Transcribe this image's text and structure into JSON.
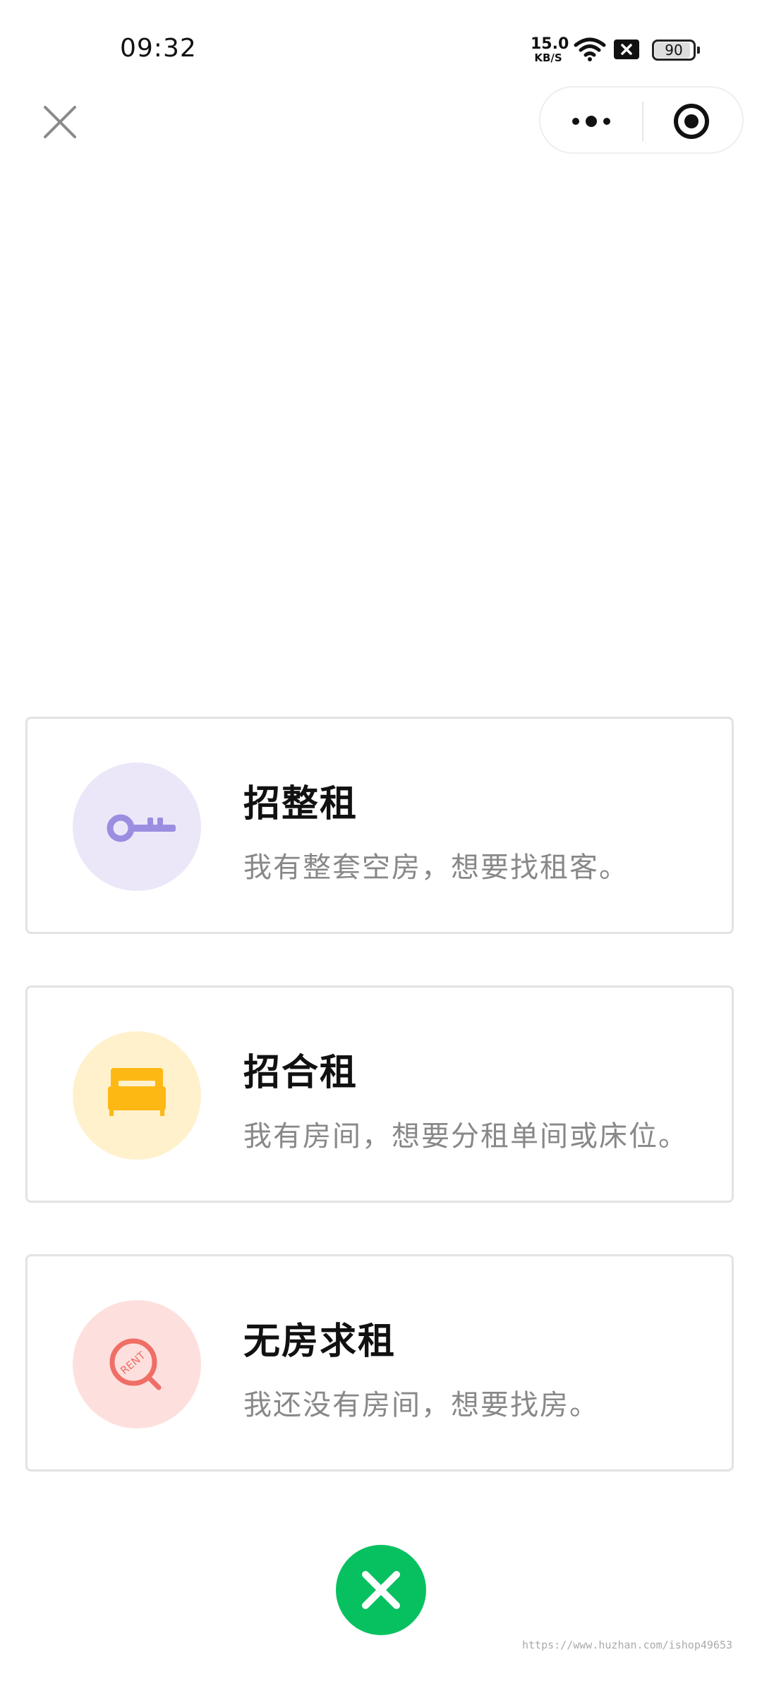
{
  "status_bar": {
    "time": "09:32",
    "net_speed_value": "15.0",
    "net_speed_unit": "KB/S",
    "battery_level": "90"
  },
  "nav": {
    "close_icon": "close-icon",
    "more_icon": "more-dots-icon",
    "target_icon": "target-icon"
  },
  "options": [
    {
      "title": "招整租",
      "desc": "我有整套空房，想要找租客。",
      "icon": "key-icon",
      "icon_bg": "#ebe7f8",
      "icon_color": "#9b8ee0"
    },
    {
      "title": "招合租",
      "desc": "我有房间，想要分租单间或床位。",
      "icon": "bed-icon",
      "icon_bg": "#fff1cc",
      "icon_color": "#fdb813"
    },
    {
      "title": "无房求租",
      "desc": "我还没有房间，想要找房。",
      "icon": "rent-search-icon",
      "icon_bg": "#fde0de",
      "icon_color": "#ef6e66"
    }
  ],
  "fab": {
    "icon": "close-icon",
    "color": "#07c160"
  },
  "watermark": "https://www.huzhan.com/ishop49653"
}
